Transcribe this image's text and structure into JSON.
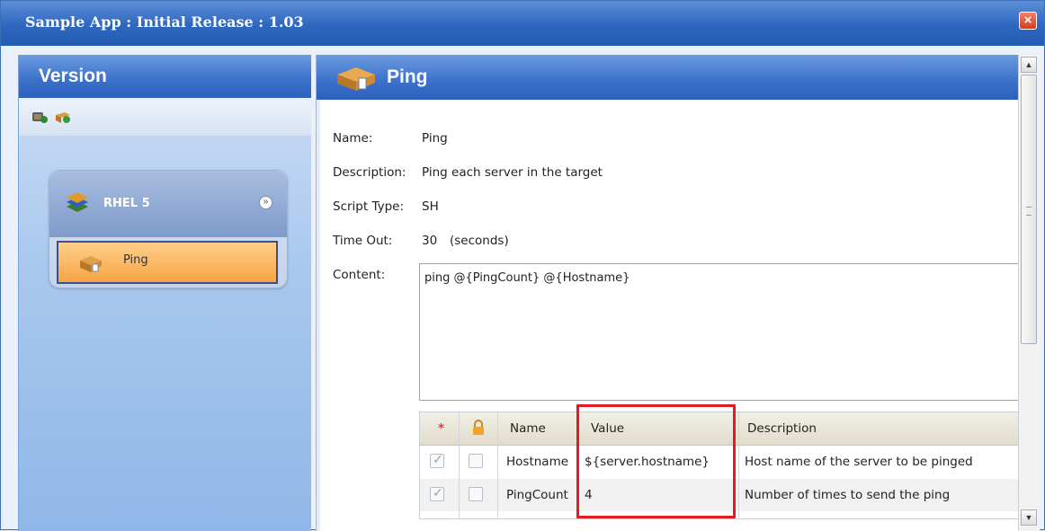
{
  "window": {
    "title": "Sample App : Initial Release : 1.03",
    "close_symbol": "×"
  },
  "left_pane": {
    "header": "Version",
    "toolbar_icons": [
      "add-script-icon",
      "add-group-icon"
    ],
    "group": {
      "label": "RHEL 5",
      "collapse_symbol": "»"
    },
    "item": {
      "label": "Ping"
    }
  },
  "right_pane": {
    "header": "Ping",
    "fields": {
      "name": {
        "label": "Name:",
        "value": "Ping"
      },
      "description": {
        "label": "Description:",
        "value": "Ping each server in the target"
      },
      "script_type": {
        "label": "Script Type:",
        "value": "SH"
      },
      "time_out": {
        "label": "Time Out:",
        "value": "30",
        "unit": "(seconds)"
      },
      "content": {
        "label": "Content:",
        "value": "ping @{PingCount} @{Hostname}"
      }
    },
    "grid": {
      "headers": {
        "required": "*",
        "lock": "lock-icon",
        "name": "Name",
        "value": "Value",
        "description": "Description"
      },
      "rows": [
        {
          "required": true,
          "locked": false,
          "name": "Hostname",
          "value": "${server.hostname}",
          "description": "Host name of the server to be pinged"
        },
        {
          "required": true,
          "locked": false,
          "name": "PingCount",
          "value": "4",
          "description": "Number of times to send the ping"
        }
      ]
    }
  },
  "colors": {
    "header_blue": "#2f67c0",
    "selected_item": "#f7a445",
    "highlight_red": "#e21b22"
  }
}
